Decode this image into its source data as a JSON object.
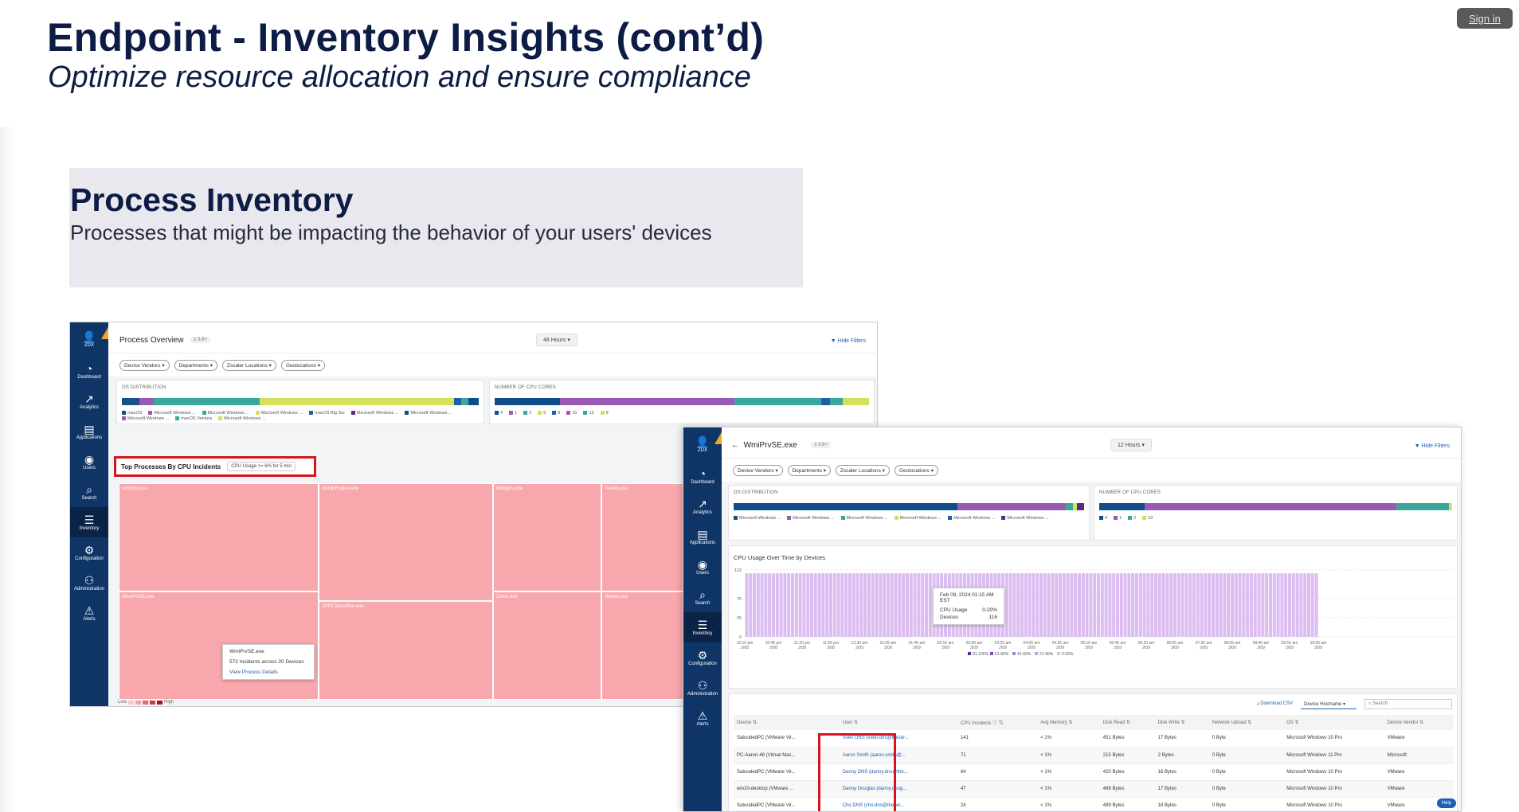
{
  "signin": "Sign in",
  "title": "Endpoint - Inventory Insights (cont’d)",
  "subtitle": "Optimize resource allocation and ensure compliance",
  "section": {
    "title": "Process Inventory",
    "description": "Processes that might be impacting the behavior of your users' devices"
  },
  "sidebar": {
    "logo": "ZDX",
    "items": [
      {
        "label": "Dashboard",
        "icon": "◔"
      },
      {
        "label": "Analytics",
        "icon": "↗"
      },
      {
        "label": "Applications",
        "icon": "▤"
      },
      {
        "label": "Users",
        "icon": "◉"
      },
      {
        "label": "Search",
        "icon": "⌕"
      },
      {
        "label": "Inventory",
        "icon": "☰"
      },
      {
        "label": "Configuration",
        "icon": "⚙"
      },
      {
        "label": "Administration",
        "icon": "⚇"
      },
      {
        "label": "Alerts",
        "icon": "⚠"
      }
    ],
    "badge": "NEW"
  },
  "filters": [
    "Device Vendors",
    "Departments",
    "Zscaler Locations",
    "Geolocations"
  ],
  "hide_filters": "Hide Filters",
  "shot1": {
    "title": "Process Overview",
    "version": "≡ 3.8+",
    "hours": "48 Hours",
    "os_title": "OS DISTRIBUTION",
    "os_legend": [
      "macOS",
      "Microsoft Windows ...",
      "Microsoft Windows ...",
      "Microsoft Windows ...",
      "macOS Big Sur",
      "Microsoft Windows ...",
      "Microsoft Windows ...",
      "Microsoft Windows ...",
      "macOS Ventura",
      "Microsoft Windows ..."
    ],
    "cpu_title": "NUMBER OF CPU CORES",
    "cpu_legend": [
      "4",
      "1",
      "2",
      "6",
      "8",
      "10",
      "12",
      "8"
    ],
    "top_title": "Top Processes By CPU Incidents",
    "top_cpu": "CPU Usage  >=  6%  for  5  min",
    "processes": [
      "svchost.exe",
      "MsMpEngine.exe",
      "Widgets.exe",
      "Teams.exe",
      "WmiPrvSE.exe",
      "ZSPCSecuMon.exe",
      "Zoom.exe",
      "Teams.exe"
    ],
    "tooltip": {
      "name": "WmiPrvSE.exe",
      "stat": "572 Incidents across 20 Devices",
      "link": "View Process Details"
    },
    "scale_low": "Low",
    "scale_high": "High"
  },
  "shot2": {
    "title": "WmiPrvSE.exe",
    "version": "≡ 3.8+",
    "hours": "12 Hours",
    "os_title": "OS DISTRIBUTION",
    "os_legend": [
      "Microsoft Windows ...",
      "Microsoft Windows ...",
      "Microsoft Windows ...",
      "Microsoft Windows ...",
      "Microsoft Windows ...",
      "Microsoft Windows ..."
    ],
    "cpu_title": "NUMBER OF CPU CORES",
    "cpu_legend": [
      "4",
      "1",
      "2",
      "10"
    ],
    "chart_title": "CPU Usage Over Time by Devices",
    "tooltip": {
      "date": "Feb 09, 2024 01:15 AM EST",
      "cpu_label": "CPU Usage",
      "cpu_val": "0-20%",
      "dev_label": "Devices",
      "dev_val": "116"
    },
    "legend": [
      "81-100%",
      "61-80%",
      "41-60%",
      "21-40%",
      "0-20%"
    ],
    "download": "Download CSV",
    "select": "Device Hostname",
    "search": "Search",
    "help": "Help",
    "columns": [
      "Device",
      "User",
      "CPU Incidents",
      "Avg Memory",
      "Disk Read",
      "Disk Write",
      "Network Upload",
      "OS",
      "Device Vendor"
    ],
    "rows": [
      [
        "SaturatedPC (VMware Vir...",
        "Sven DNS (sven.dns@thezer...",
        "141",
        "< 1%",
        "451 Bytes",
        "17 Bytes",
        "0 Byte",
        "Microsoft Windows 10 Pro",
        "VMware"
      ],
      [
        "PC-Aaron-48 (Virtual Mac...",
        "Aaron Smith (aaron.smith@...",
        "71",
        "< 1%",
        "215 Bytes",
        "2 Bytes",
        "0 Byte",
        "Microsoft Windows 11 Pro",
        "Microsoft"
      ],
      [
        "SaturatedPC (VMware Vir...",
        "Danny DNS (danny.dns@the...",
        "64",
        "< 1%",
        "420 Bytes",
        "16 Bytes",
        "0 Byte",
        "Microsoft Windows 10 Pro",
        "VMware"
      ],
      [
        "win10-desktop (VMware ...",
        "Danny Douglas (danny.doug...",
        "47",
        "< 1%",
        "468 Bytes",
        "17 Bytes",
        "0 Byte",
        "Microsoft Windows 10 Pro",
        "VMware"
      ],
      [
        "SaturatedPC (VMware Vir...",
        "Cho DNS (cho.dns@thezer...",
        "24",
        "< 1%",
        "489 Bytes",
        "18 Bytes",
        "0 Byte",
        "Microsoft Windows 10 Pro",
        "VMware"
      ]
    ]
  },
  "chart_data": {
    "type": "bar",
    "title": "CPU Usage Over Time by Devices",
    "ylim": [
      0,
      122
    ],
    "yticks": [
      0,
      35,
      70,
      122
    ],
    "xticks": [
      "10:10 pm 2/08",
      "10:45 pm 2/08",
      "11:20 pm 2/08",
      "11:55 pm 2/08",
      "12:30 am 2/09",
      "01:05 am 2/09",
      "01:40 am 2/09",
      "02:15 am 2/09",
      "02:50 am 2/09",
      "03:25 am 2/09",
      "04:00 am 2/09",
      "04:35 am 2/09",
      "05:10 am 2/09",
      "05:45 am 2/09",
      "06:20 am 2/09",
      "06:55 am 2/09",
      "07:30 am 2/09",
      "08:05 am 2/09",
      "08:40 am 2/09",
      "09:15 am 2/09",
      "10:05 am 2/09"
    ],
    "series": [
      {
        "name": "0-20%",
        "value": 116
      }
    ]
  },
  "colors": {
    "sidebar": "#0f3567",
    "treemap": "#f8a8ad",
    "highlight": "#d7141e",
    "bar": "#dcbdf2",
    "os": [
      "#0e4c8a",
      "#9b59b6",
      "#3aa79b",
      "#d5e05b",
      "#1d5fae",
      "#5b2a86"
    ]
  }
}
